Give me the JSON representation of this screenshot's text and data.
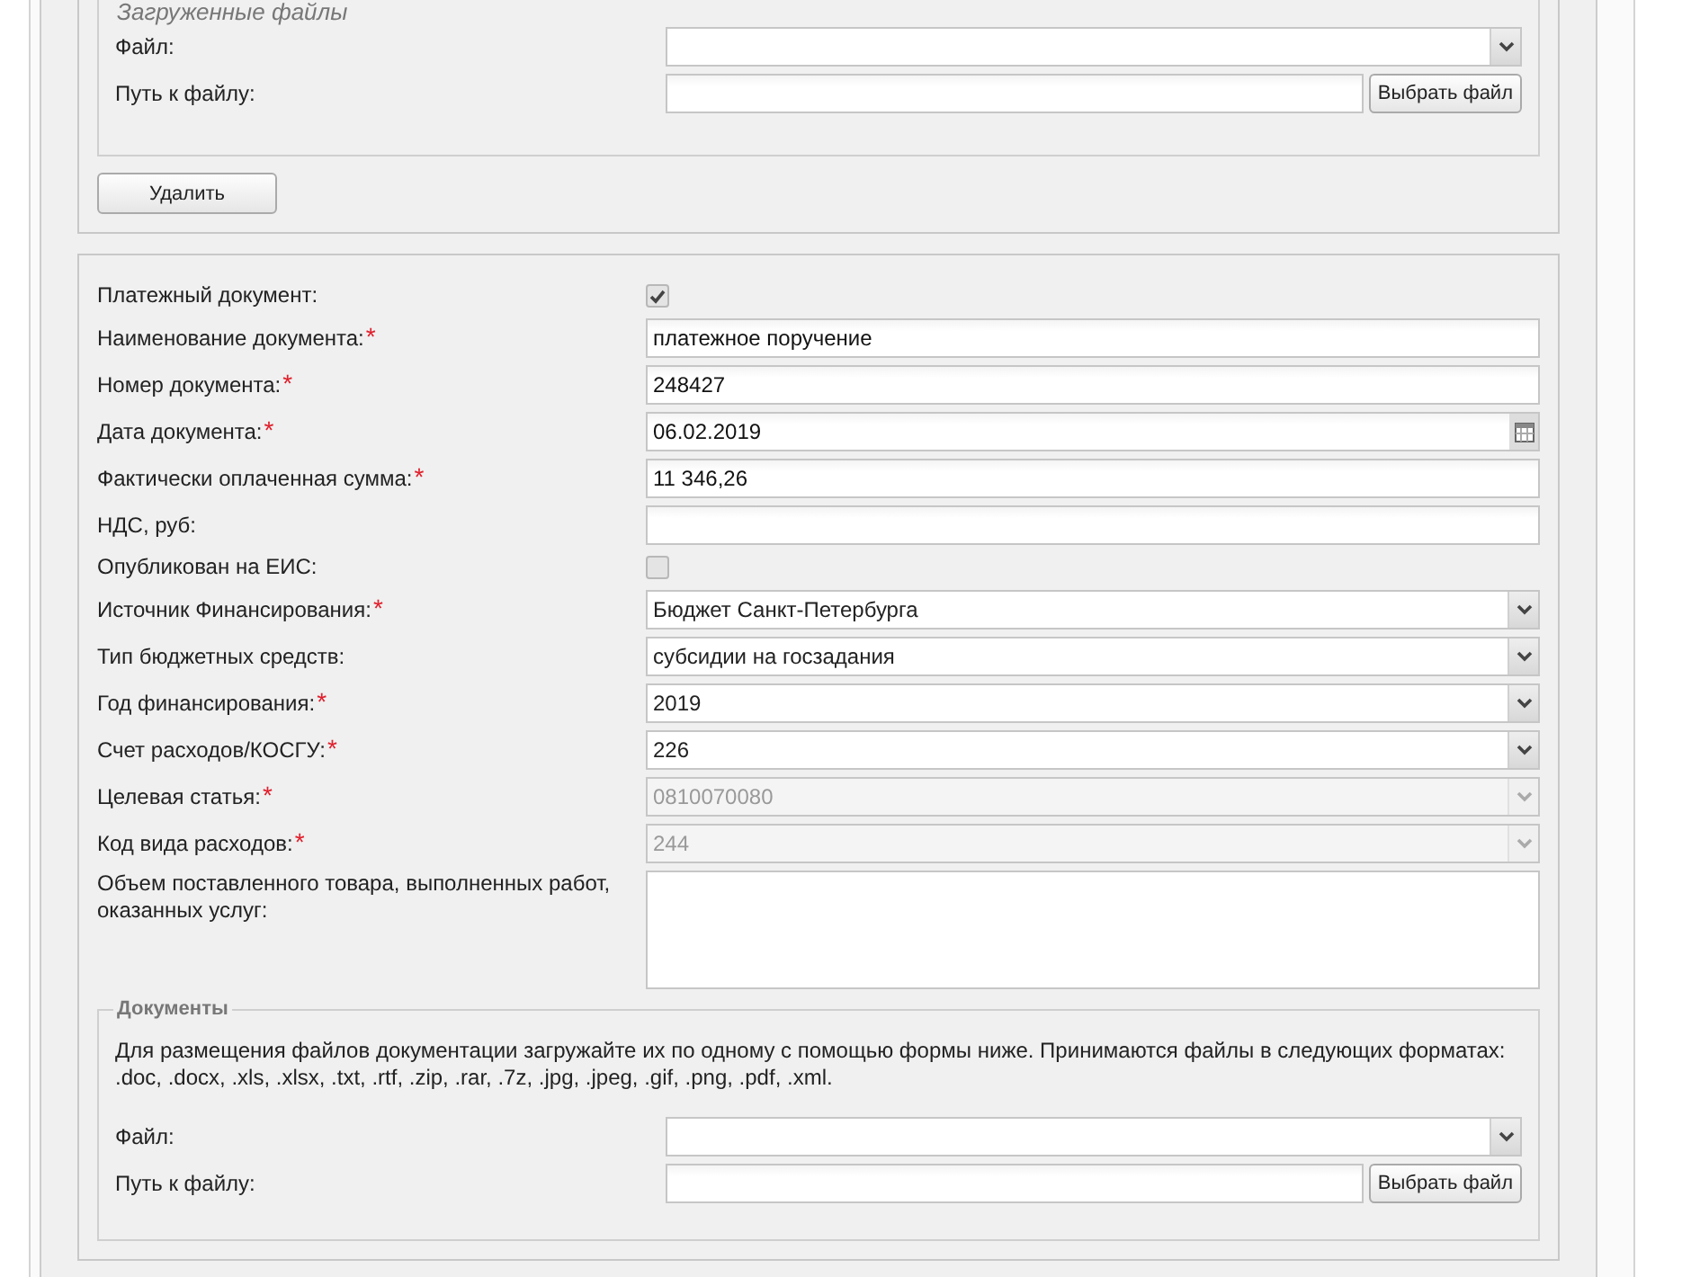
{
  "uploaded_files": {
    "legend": "Загруженные файлы",
    "rows": [
      {
        "kind": "select",
        "label": "Файл:"
      },
      {
        "kind": "file",
        "label": "Путь к файлу:",
        "button": "Выбрать файл"
      }
    ]
  },
  "delete_button": "Удалить",
  "payment_form": {
    "fields": [
      {
        "kind": "checkbox",
        "label": "Платежный документ:",
        "checked": true
      },
      {
        "kind": "text",
        "label": "Наименование документа:",
        "mark": "*",
        "value": "платежное поручение"
      },
      {
        "kind": "text",
        "label": "Номер документа:",
        "mark": "*",
        "value": "248427"
      },
      {
        "kind": "date",
        "label": "Дата документа:",
        "mark": "*",
        "value": "06.02.2019"
      },
      {
        "kind": "text",
        "label": "Фактически оплаченная сумма:",
        "mark": "*",
        "value": "11 346,26"
      },
      {
        "kind": "text",
        "label": "НДС, руб:"
      },
      {
        "kind": "checkbox",
        "label": "Опубликован на ЕИС:",
        "checked": false
      },
      {
        "kind": "select",
        "label": "Источник Финансирования:",
        "mark": "*",
        "value": "Бюджет Санкт-Петербурга",
        "disabled": false
      },
      {
        "kind": "select",
        "label": "Тип бюджетных средств:",
        "value": "субсидии на госзадания",
        "disabled": false
      },
      {
        "kind": "select",
        "label": "Год финансирования:",
        "mark": "*",
        "value": "2019",
        "disabled": false
      },
      {
        "kind": "select",
        "label": "Счет расходов/КОСГУ:",
        "mark": "*",
        "value": "226",
        "disabled": false
      },
      {
        "kind": "select",
        "label": "Целевая статья:",
        "mark": "*",
        "value": "0810070080",
        "disabled": true
      },
      {
        "kind": "select",
        "label": "Код вида расходов:",
        "mark": "*",
        "value": "244",
        "disabled": true
      },
      {
        "kind": "textarea",
        "label": "Объем поставленного товара, выполненных работ, оказанных услуг:"
      }
    ]
  },
  "documents": {
    "legend": "Документы",
    "note": "Для размещения файлов документации загружайте их по одному с помощью формы ниже. Принимаются файлы в следующих форматах: .doc, .docx, .xls, .xlsx, .txt, .rtf, .zip, .rar, .7z, .jpg, .jpeg, .gif, .png, .pdf, .xml.",
    "rows": [
      {
        "kind": "select",
        "label": "Файл:"
      },
      {
        "kind": "file",
        "label": "Путь к файлу:",
        "button": "Выбрать файл"
      }
    ]
  }
}
